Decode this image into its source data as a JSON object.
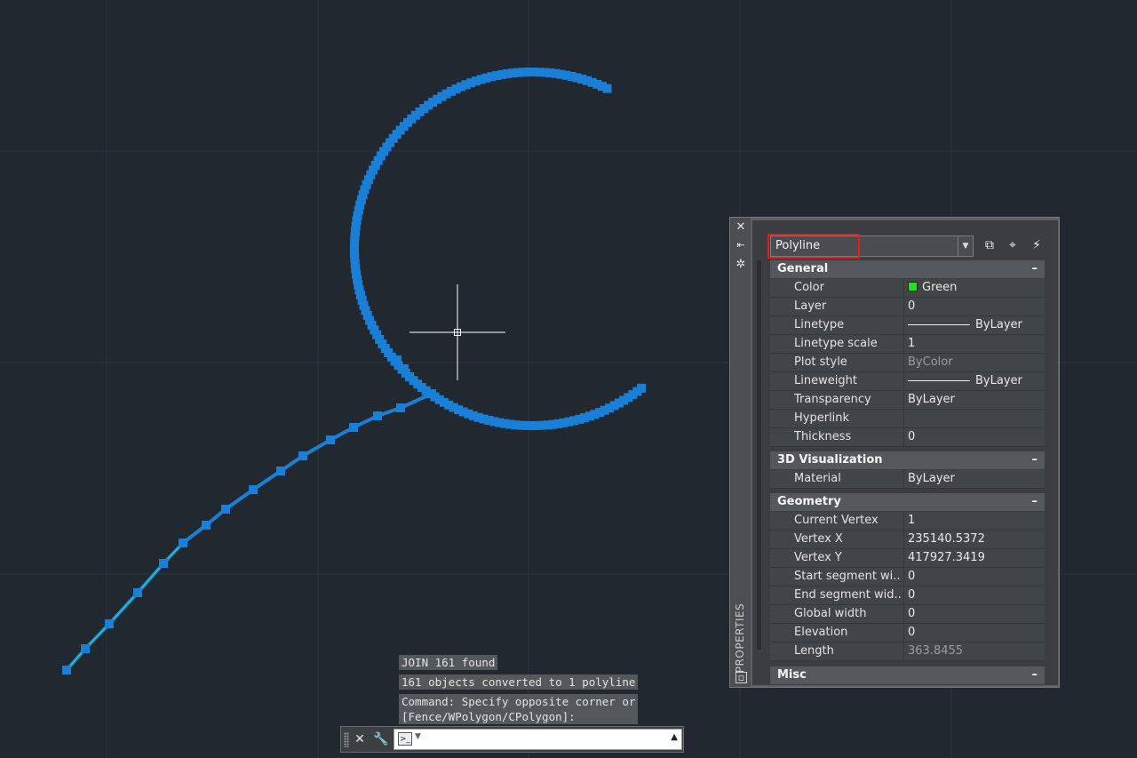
{
  "command_history": [
    "JOIN 161 found",
    "161 objects converted to 1 polyline",
    "Command: Specify opposite corner or\n[Fence/WPolygon/CPolygon]:"
  ],
  "command_line": {
    "close_icon": "close-icon",
    "customize_icon": "wrench-icon",
    "prompt_icon": ">_",
    "input_value": ""
  },
  "properties": {
    "title": "PROPERTIES",
    "object_type": "Polyline",
    "sections": {
      "general": {
        "label": "General",
        "color_name": "Green",
        "color_hex": "#22e022",
        "rows": [
          {
            "name": "Color",
            "value": "Green"
          },
          {
            "name": "Layer",
            "value": "0"
          },
          {
            "name": "Linetype",
            "value": "ByLayer"
          },
          {
            "name": "Linetype scale",
            "value": "1"
          },
          {
            "name": "Plot style",
            "value": "ByColor"
          },
          {
            "name": "Lineweight",
            "value": "ByLayer"
          },
          {
            "name": "Transparency",
            "value": "ByLayer"
          },
          {
            "name": "Hyperlink",
            "value": ""
          },
          {
            "name": "Thickness",
            "value": "0"
          }
        ]
      },
      "visualization": {
        "label": "3D Visualization",
        "rows": [
          {
            "name": "Material",
            "value": "ByLayer"
          }
        ]
      },
      "geometry": {
        "label": "Geometry",
        "rows": [
          {
            "name": "Current Vertex",
            "value": "1"
          },
          {
            "name": "Vertex X",
            "value": "235140.5372"
          },
          {
            "name": "Vertex Y",
            "value": "417927.3419"
          },
          {
            "name": "Start segment wi...",
            "value": "0"
          },
          {
            "name": "End segment wid...",
            "value": "0"
          },
          {
            "name": "Global width",
            "value": "0"
          },
          {
            "name": "Elevation",
            "value": "0"
          },
          {
            "name": "Length",
            "value": "363.8455"
          }
        ]
      },
      "misc": {
        "label": "Misc"
      }
    }
  }
}
